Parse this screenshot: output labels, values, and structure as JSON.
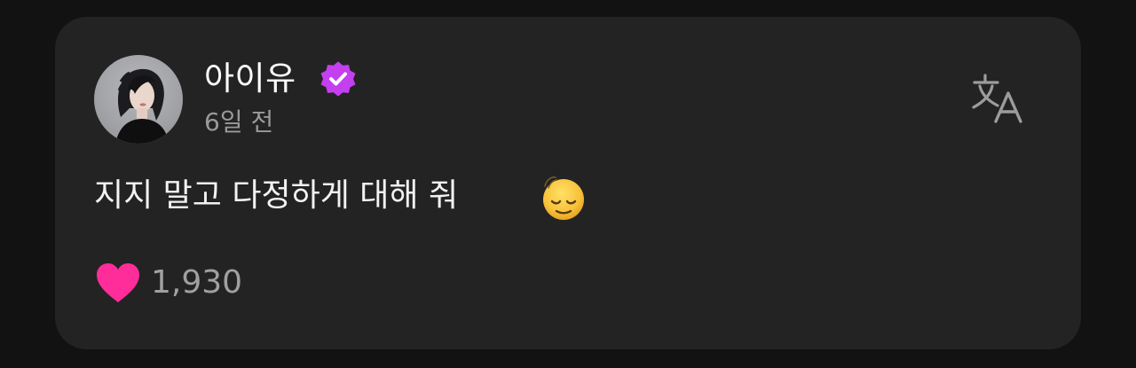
{
  "post": {
    "author_name": "아이유",
    "time_ago": "6일 전",
    "text": "지지 말고 다정하게 대해 줘",
    "emoji": "😌",
    "like_count": "1,930"
  },
  "icons": {
    "verified": "verified-badge-icon",
    "translate": "translate-icon",
    "like": "heart-icon"
  },
  "colors": {
    "background": "#121212",
    "card": "#232323",
    "verified_badge": "#c43ff0",
    "heart": "#ff2d9a",
    "emoji_face": "#f7c23a"
  }
}
